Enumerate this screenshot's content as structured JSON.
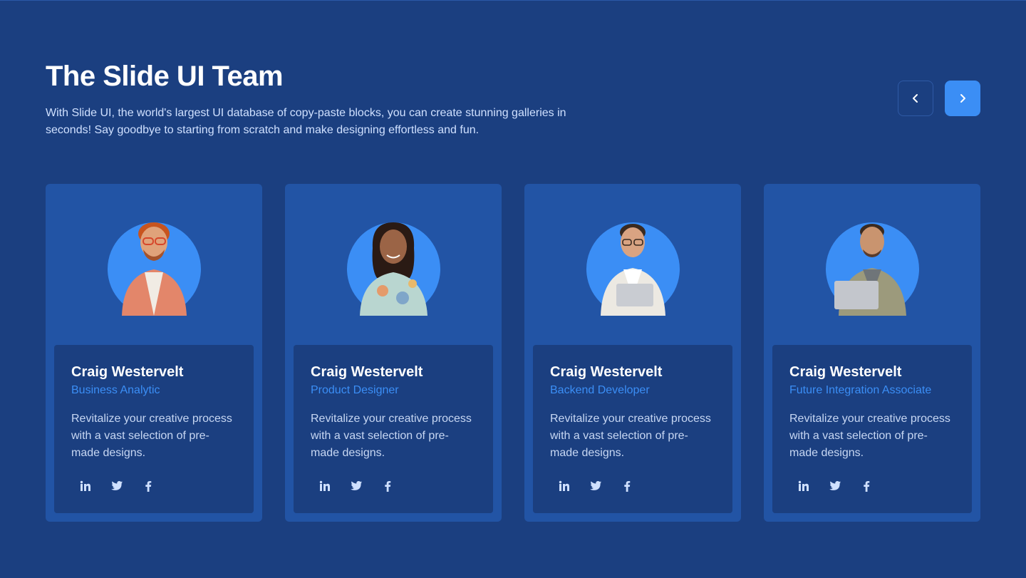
{
  "header": {
    "title": "The Slide UI Team",
    "subtitle": "With Slide UI, the world's largest UI database of copy-paste blocks, you can create stunning galleries in seconds! Say goodbye to starting from scratch and make designing effortless and fun."
  },
  "nav": {
    "prev_icon": "chevron-left-icon",
    "next_icon": "chevron-right-icon"
  },
  "colors": {
    "background": "#1b3f80",
    "card": "#2254a5",
    "accent": "#3b8ef5"
  },
  "cards": [
    {
      "name": "Craig Westervelt",
      "role": "Business Analytic",
      "bio": "Revitalize your creative process with a vast selection of pre-made designs.",
      "socials": [
        "linkedin-icon",
        "twitter-icon",
        "facebook-icon"
      ]
    },
    {
      "name": "Craig Westervelt",
      "role": "Product Designer",
      "bio": "Revitalize your creative process with a vast selection of pre-made designs.",
      "socials": [
        "linkedin-icon",
        "twitter-icon",
        "facebook-icon"
      ]
    },
    {
      "name": "Craig Westervelt",
      "role": "Backend Developer",
      "bio": "Revitalize your creative process with a vast selection of pre-made designs.",
      "socials": [
        "linkedin-icon",
        "twitter-icon",
        "facebook-icon"
      ]
    },
    {
      "name": "Craig Westervelt",
      "role": "Future Integration Associate",
      "bio": "Revitalize your creative process with a vast selection of pre-made designs.",
      "socials": [
        "linkedin-icon",
        "twitter-icon",
        "facebook-icon"
      ]
    }
  ]
}
